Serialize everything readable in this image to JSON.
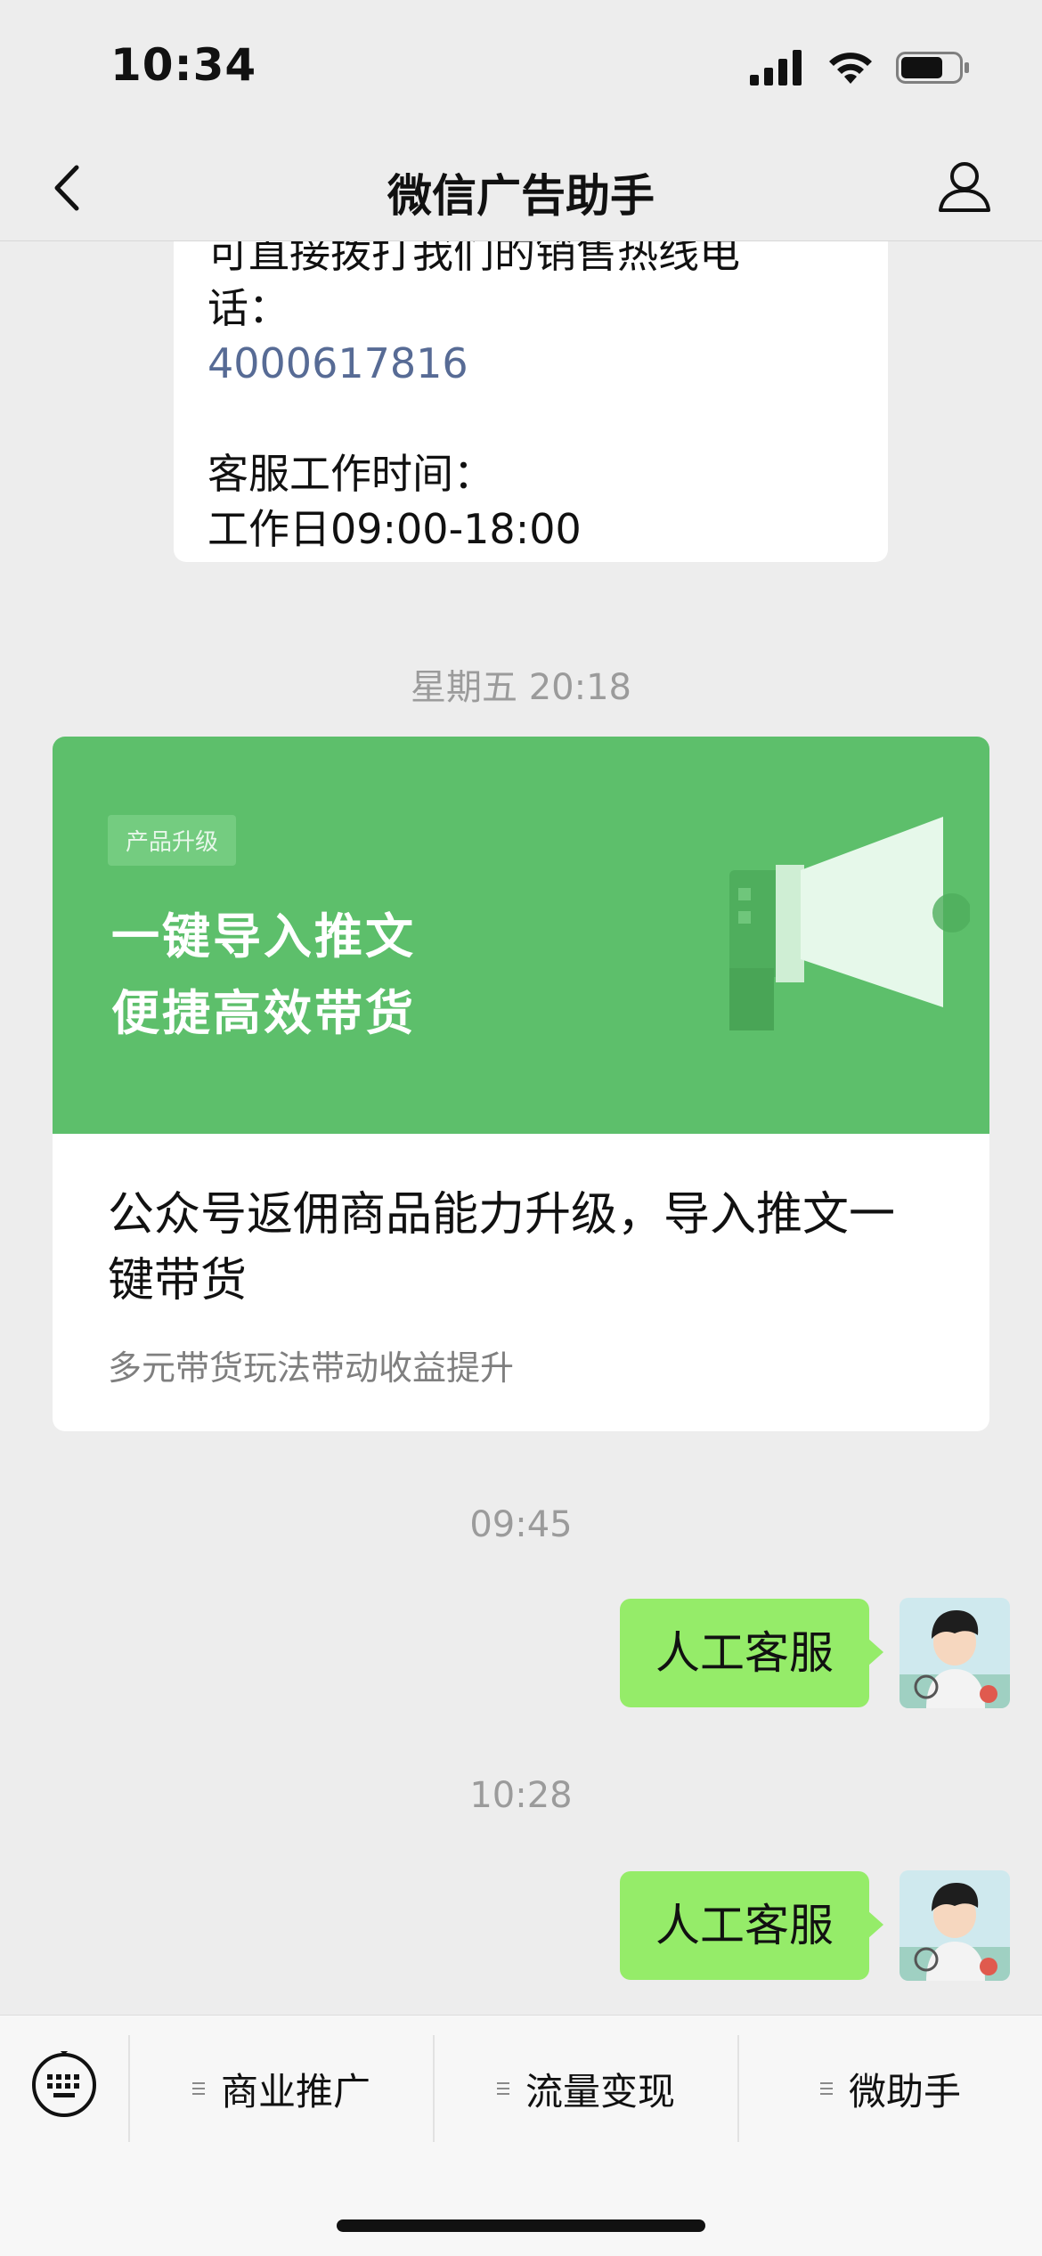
{
  "status_bar": {
    "time": "10:34"
  },
  "nav": {
    "title": "微信广告助手",
    "back_icon": "chevron-left-icon",
    "profile_icon": "person-icon"
  },
  "card_message": {
    "line1": "可直接拨打我们的销售热线电",
    "line2": "话：",
    "phone": "4000617816",
    "hours_label": "客服工作时间：",
    "hours_value": "工作日09:00-18:00"
  },
  "timestamps": [
    "星期五 20:18",
    "09:45",
    "10:28"
  ],
  "promo": {
    "tag": "产品升级",
    "slogan_line1": "一键导入推文",
    "slogan_line2": "便捷高效带货",
    "headline": "公众号返佣商品能力升级，导入推文一键带货",
    "subtitle": "多元带货玩法带动收益提升",
    "banner_color": "#5dbf6b"
  },
  "messages": [
    {
      "text": "人工客服",
      "from": "me"
    },
    {
      "text": "人工客服",
      "from": "me"
    }
  ],
  "menu": {
    "keyboard_icon": "keyboard-icon",
    "items": [
      "商业推广",
      "流量变现",
      "微助手"
    ]
  },
  "colors": {
    "my_bubble": "#95ec69",
    "link": "#576b95"
  }
}
